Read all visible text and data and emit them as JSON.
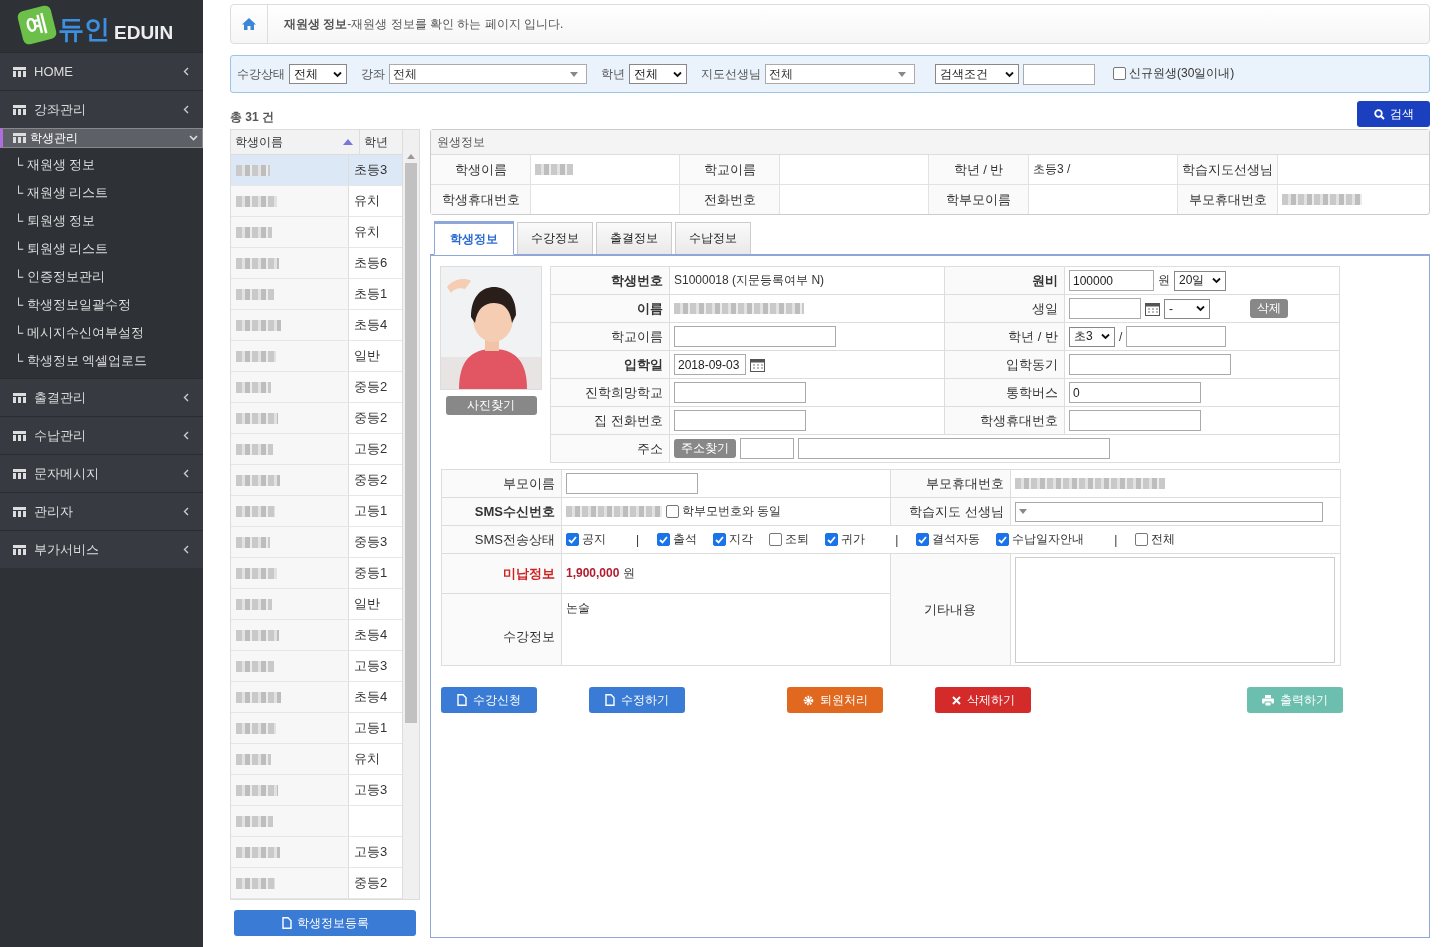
{
  "logo": {
    "mark": "예",
    "name": "듀인",
    "latin": "EDUIN"
  },
  "sidebar": {
    "items": [
      {
        "label": "HOME",
        "selected": false,
        "expanded": false
      },
      {
        "label": "강좌관리",
        "selected": false,
        "expanded": false
      },
      {
        "label": "학생관리",
        "selected": true,
        "expanded": true,
        "children": [
          {
            "label": "└ 재원생 정보"
          },
          {
            "label": "└ 재원생 리스트"
          },
          {
            "label": "└ 퇴원생 정보"
          },
          {
            "label": "└ 퇴원생 리스트"
          },
          {
            "label": "└ 인증정보관리"
          },
          {
            "label": "└ 학생정보일괄수정"
          },
          {
            "label": "└ 메시지수신여부설정"
          },
          {
            "label": "└ 학생정보 엑셀업로드"
          }
        ]
      },
      {
        "label": "출결관리",
        "selected": false,
        "expanded": false
      },
      {
        "label": "수납관리",
        "selected": false,
        "expanded": false
      },
      {
        "label": "문자메시지",
        "selected": false,
        "expanded": false
      },
      {
        "label": "관리자",
        "selected": false,
        "expanded": false
      },
      {
        "label": "부가서비스",
        "selected": false,
        "expanded": false
      }
    ]
  },
  "breadcrumb": {
    "title": "재원생 정보",
    "description": "-재원생 정보를 확인 하는 페이지 입니다."
  },
  "filters": [
    {
      "kind": "select",
      "label": "수강상태",
      "value": "전체"
    },
    {
      "kind": "combo",
      "label": "강좌",
      "value": "전체"
    },
    {
      "kind": "select",
      "label": "학년",
      "value": "전체"
    },
    {
      "kind": "combo",
      "label": "지도선생님",
      "value": "전체"
    },
    {
      "kind": "select",
      "value": "검색조건"
    },
    {
      "kind": "input"
    },
    {
      "kind": "checkbox",
      "label": "신규원생(30일이내)",
      "checked": false
    }
  ],
  "total": "총 31 건",
  "search_button": "검색",
  "student_list": {
    "columns": [
      "학생이름",
      "학년"
    ],
    "rows": [
      {
        "grade": "초등3",
        "selected": true
      },
      {
        "grade": "유치",
        "selected": false
      },
      {
        "grade": "유치",
        "selected": false
      },
      {
        "grade": "초등6",
        "selected": false
      },
      {
        "grade": "초등1",
        "selected": false
      },
      {
        "grade": "초등4",
        "selected": false
      },
      {
        "grade": "일반",
        "selected": false
      },
      {
        "grade": "중등2",
        "selected": false
      },
      {
        "grade": "중등2",
        "selected": false
      },
      {
        "grade": "고등2",
        "selected": false
      },
      {
        "grade": "중등2",
        "selected": false
      },
      {
        "grade": "고등1",
        "selected": false
      },
      {
        "grade": "중등3",
        "selected": false
      },
      {
        "grade": "중등1",
        "selected": false
      },
      {
        "grade": "일반",
        "selected": false
      },
      {
        "grade": "초등4",
        "selected": false
      },
      {
        "grade": "고등3",
        "selected": false
      },
      {
        "grade": "초등4",
        "selected": false
      },
      {
        "grade": "고등1",
        "selected": false
      },
      {
        "grade": "유치",
        "selected": false
      },
      {
        "grade": "고등3",
        "selected": false
      },
      {
        "selected": false
      },
      {
        "grade": "고등3",
        "selected": false
      },
      {
        "grade": "중등2",
        "selected": false
      }
    ],
    "register_button": "학생정보등록"
  },
  "summary": {
    "title": "원생정보",
    "rows": [
      [
        {
          "label": "학생이름",
          "blurred": true
        },
        {
          "label": "학교이름"
        },
        {
          "label": "학년 / 반",
          "value": "초등3 /"
        },
        {
          "label": "학습지도선생님"
        }
      ],
      [
        {
          "label": "학생휴대번호"
        },
        {
          "label": "전화번호"
        },
        {
          "label": "학부모이름"
        },
        {
          "label": "부모휴대번호",
          "blurred": true
        }
      ]
    ]
  },
  "tabs": [
    {
      "label": "학생정보",
      "selected": true
    },
    {
      "label": "수강정보",
      "selected": false
    },
    {
      "label": "출결정보",
      "selected": false
    },
    {
      "label": "수납정보",
      "selected": false
    }
  ],
  "student_form": {
    "photo": {
      "kind": "picture"
    },
    "photo_button": "사진찾기",
    "rows": [
      [
        {
          "label": "학생번호",
          "bold": true,
          "fields": [
            {
              "kind": "text",
              "value": "S1000018 (지문등록여부 N)"
            }
          ]
        },
        {
          "label": "원비",
          "bold": true,
          "fields": [
            {
              "kind": "input",
              "value": "100000"
            },
            {
              "kind": "unit",
              "value": "원"
            },
            {
              "kind": "select",
              "value": "20일"
            }
          ]
        }
      ],
      [
        {
          "label": "이름",
          "bold": true,
          "fields": [
            {
              "kind": "blurred"
            }
          ]
        },
        {
          "label": "생일",
          "fields": [
            {
              "kind": "date"
            },
            {
              "kind": "select",
              "value": "-"
            },
            {
              "kind": "button",
              "value": "삭제"
            }
          ]
        }
      ],
      [
        {
          "label": "학교이름",
          "fields": [
            {
              "kind": "input"
            }
          ]
        },
        {
          "label": "학년 / 반",
          "fields": [
            {
              "kind": "select",
              "value": "초3"
            },
            {
              "kind": "unit",
              "value": "/"
            },
            {
              "kind": "input"
            }
          ]
        }
      ],
      [
        {
          "label": "입학일",
          "bold": true,
          "fields": [
            {
              "kind": "date",
              "value": "2018-09-03"
            }
          ]
        },
        {
          "label": "입학동기",
          "fields": [
            {
              "kind": "input"
            }
          ]
        }
      ],
      [
        {
          "label": "진학희망학교",
          "fields": [
            {
              "kind": "input"
            }
          ]
        },
        {
          "label": "통학버스",
          "fields": [
            {
              "kind": "input",
              "value": "0"
            }
          ]
        }
      ],
      [
        {
          "label": "집 전화번호",
          "fields": [
            {
              "kind": "input"
            }
          ]
        },
        {
          "label": "학생휴대번호",
          "fields": [
            {
              "kind": "input"
            }
          ]
        }
      ],
      [
        {
          "label": "주소",
          "fields": [
            {
              "kind": "button",
              "value": "주소찾기"
            },
            {
              "kind": "input"
            },
            {
              "kind": "input"
            }
          ]
        }
      ]
    ]
  },
  "contact_form": {
    "rows": [
      [
        {
          "label": "부모이름",
          "fields": [
            {
              "kind": "input"
            }
          ]
        },
        {
          "label": "부모휴대번호",
          "fields": [
            {
              "kind": "blurred"
            }
          ]
        }
      ],
      [
        {
          "label": "SMS수신번호",
          "bold": true,
          "fields": [
            {
              "kind": "blurred"
            },
            {
              "kind": "checkbox",
              "value": "학부모번호와 동일",
              "checked": false
            }
          ]
        },
        {
          "label": "학습지도 선생님",
          "fields": [
            {
              "kind": "combo"
            }
          ]
        }
      ],
      [
        {
          "label": "SMS전송상태",
          "fields": [
            {
              "kind": "checkbox",
              "value": "공지",
              "checked": true
            },
            {
              "kind": "separator",
              "value": "|"
            },
            {
              "kind": "checkbox",
              "value": "출석",
              "checked": true
            },
            {
              "kind": "checkbox",
              "value": "지각",
              "checked": true
            },
            {
              "kind": "checkbox",
              "value": "조퇴",
              "checked": false
            },
            {
              "kind": "checkbox",
              "value": "귀가",
              "checked": true
            },
            {
              "kind": "separator",
              "value": "|"
            },
            {
              "kind": "checkbox",
              "value": "결석자동",
              "checked": true
            },
            {
              "kind": "checkbox",
              "value": "수납일자안내",
              "checked": true
            },
            {
              "kind": "separator",
              "value": "|"
            },
            {
              "kind": "checkbox",
              "value": "전체",
              "checked": false
            }
          ]
        }
      ]
    ],
    "unpaid": {
      "label": "미납정보",
      "value": "**1,900,000** 원"
    },
    "courses": {
      "label": "수강정보",
      "value": "논술"
    },
    "notes": {
      "label": "기타내용"
    }
  },
  "actions": [
    {
      "label": "수강신청",
      "kind": "primary"
    },
    {
      "label": "수정하기",
      "kind": "primary"
    },
    {
      "label": "퇴원처리",
      "kind": "warning"
    },
    {
      "label": "삭제하기",
      "kind": "danger"
    },
    {
      "label": "출력하기",
      "kind": "info"
    }
  ]
}
